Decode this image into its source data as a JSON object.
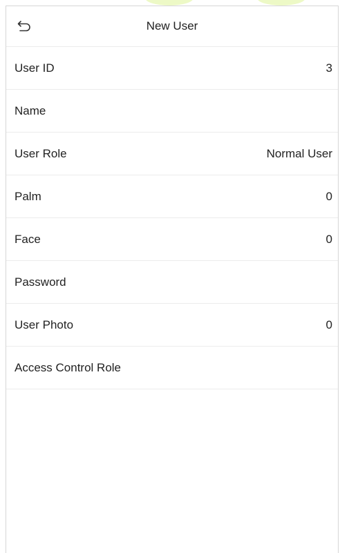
{
  "header": {
    "title": "New User",
    "back_icon": "back-arrow-icon"
  },
  "rows": [
    {
      "label": "User ID",
      "value": "3"
    },
    {
      "label": "Name",
      "value": ""
    },
    {
      "label": "User Role",
      "value": "Normal User"
    },
    {
      "label": "Palm",
      "value": "0"
    },
    {
      "label": "Face",
      "value": "0"
    },
    {
      "label": "Password",
      "value": ""
    },
    {
      "label": "User Photo",
      "value": "0"
    },
    {
      "label": "Access Control Role",
      "value": ""
    }
  ],
  "colors": {
    "background": "#ffffff",
    "divider": "#ececec",
    "text": "#222222"
  }
}
